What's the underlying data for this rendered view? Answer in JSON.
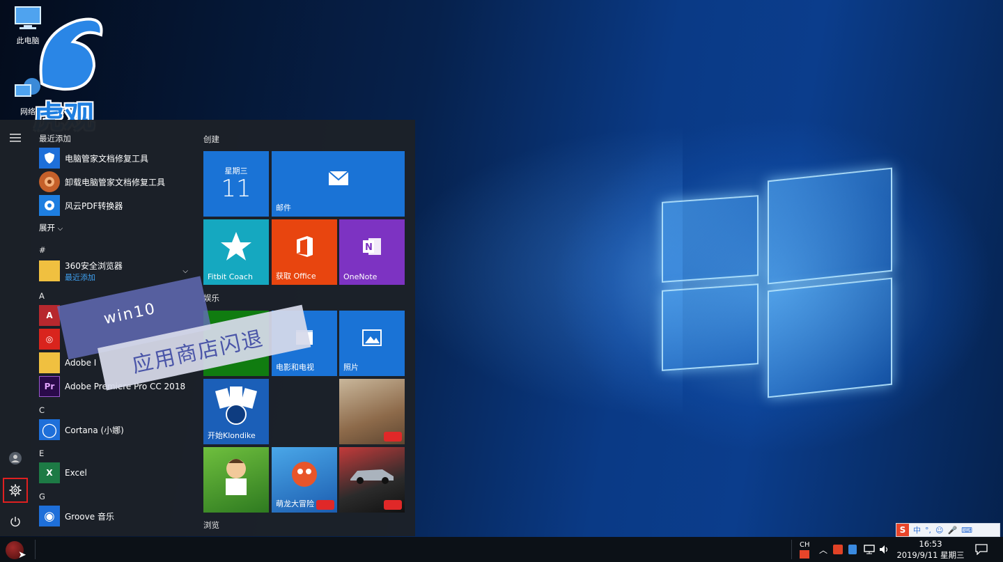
{
  "desktop": {
    "icons": [
      {
        "label": "此电脑",
        "icon": "computer-icon"
      },
      {
        "label": "网络",
        "icon": "network-icon"
      }
    ],
    "watermark": "虎观"
  },
  "start_menu": {
    "recent": {
      "header": "最近添加",
      "items": [
        {
          "label": "电脑管家文档修复工具",
          "icon": "shield-icon",
          "color": "#1e6fd9"
        },
        {
          "label": "卸载电脑管家文档修复工具",
          "icon": "uninstall-icon",
          "color": "#c5602a"
        },
        {
          "label": "风云PDF转换器",
          "icon": "pdf-converter-icon",
          "color": "#1e7ee0"
        }
      ]
    },
    "expand_label": "展开",
    "sections": [
      {
        "letter": "#",
        "items": [
          {
            "label": "360安全浏览器",
            "sub": "最近添加",
            "icon": "folder-icon",
            "color": "#f0c040"
          }
        ]
      },
      {
        "letter": "A",
        "items": [
          {
            "label": "",
            "icon": "access-icon",
            "color": "#b7282e",
            "glyph": "A"
          },
          {
            "label": "",
            "icon": "adobe-cc-icon",
            "color": "#d9241d",
            "glyph": "◎"
          },
          {
            "label": "Adobe I",
            "icon": "folder-icon",
            "color": "#f0c040",
            "glyph": ""
          },
          {
            "label": "Adobe Premiere Pro CC 2018",
            "icon": "premiere-icon",
            "color": "#2a0a4a",
            "glyph": "Pr"
          }
        ]
      },
      {
        "letter": "C",
        "items": [
          {
            "label": "Cortana (小娜)",
            "icon": "cortana-icon",
            "color": "#1e6fd9",
            "glyph": "◯"
          }
        ]
      },
      {
        "letter": "E",
        "items": [
          {
            "label": "Excel",
            "icon": "excel-icon",
            "color": "#1d7a45",
            "glyph": "X"
          }
        ]
      },
      {
        "letter": "G",
        "items": [
          {
            "label": "Groove 音乐",
            "icon": "groove-icon",
            "color": "#1e6fd9",
            "glyph": "◉"
          }
        ]
      }
    ],
    "groups": {
      "create": "创建",
      "entertainment": "娱乐",
      "browse": "浏览"
    },
    "tiles": {
      "calendar": {
        "weekday": "星期三",
        "day": "11"
      },
      "mail": "邮件",
      "fitbit": "Fitbit Coach",
      "office": "获取 Office",
      "onenote": "OneNote",
      "movies": "电影和电视",
      "photos": "照片",
      "klondike": "开始Klondike",
      "dragon": "萌龙大冒险"
    }
  },
  "overlay": {
    "line1": "win10",
    "line2": "应用商店闪退"
  },
  "taskbar": {
    "lang": "CH",
    "time": "16:53",
    "date": "2019/9/11 星期三",
    "ime_label": "中"
  }
}
